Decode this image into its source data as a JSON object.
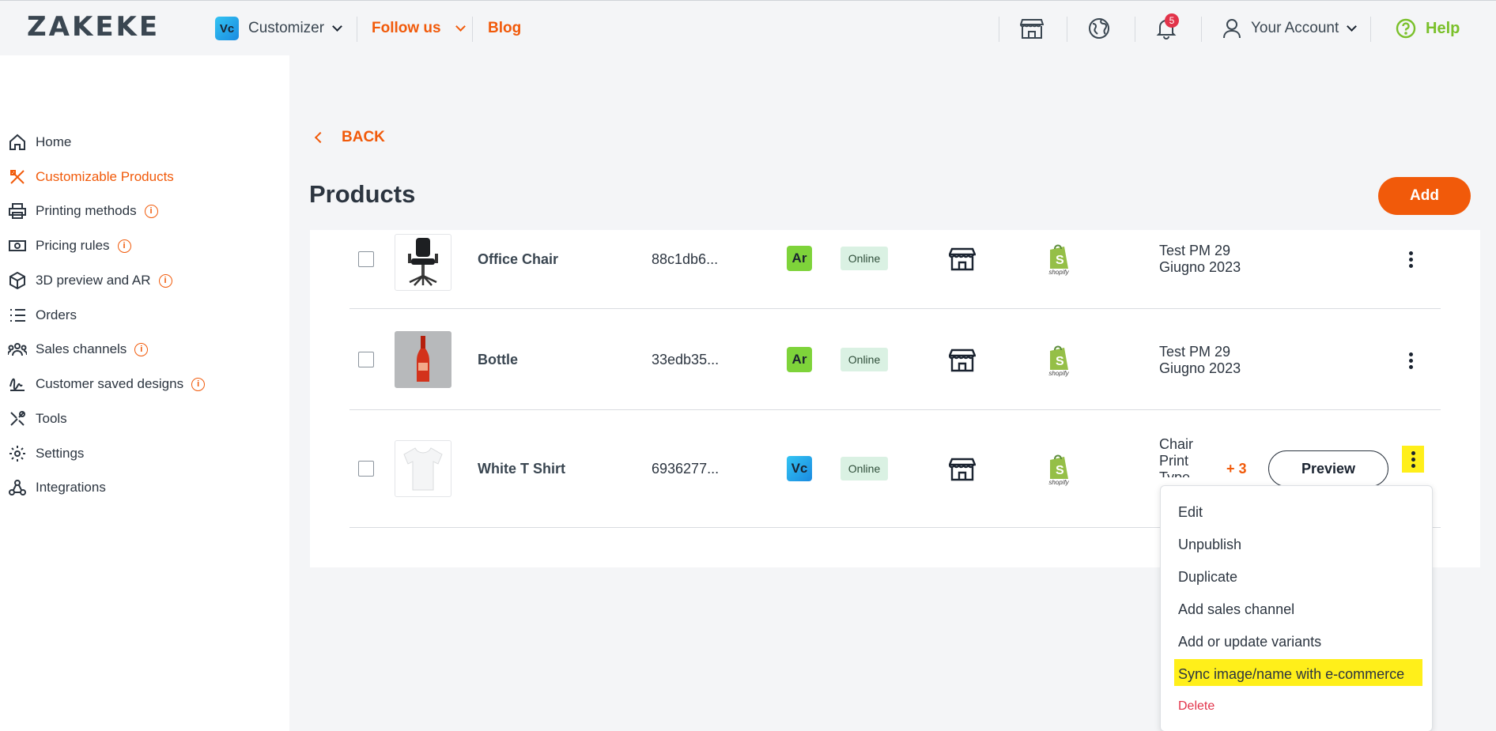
{
  "header": {
    "logo": "ZAKEKE",
    "app_badge": "Vc",
    "app_switcher": "Customizer",
    "follow_us": "Follow us",
    "blog": "Blog",
    "notifications_count": "5",
    "account": "Your Account",
    "help": "Help"
  },
  "sidebar": {
    "items": [
      {
        "label": "Home"
      },
      {
        "label": "Customizable Products"
      },
      {
        "label": "Printing methods"
      },
      {
        "label": "Pricing rules"
      },
      {
        "label": "3D preview and AR"
      },
      {
        "label": "Orders"
      },
      {
        "label": "Sales channels"
      },
      {
        "label": "Customer saved designs"
      },
      {
        "label": "Tools"
      },
      {
        "label": "Settings"
      },
      {
        "label": "Integrations"
      }
    ]
  },
  "main": {
    "back_label": "BACK",
    "title": "Products",
    "add_label": "Add",
    "products": [
      {
        "name": "Office Chair",
        "id": "88c1db6...",
        "tag": "Ar",
        "status": "Online",
        "platform": "shopify",
        "text_line1": "Test PM 29",
        "text_line2": "Giugno 2023"
      },
      {
        "name": "Bottle",
        "id": "33edb35...",
        "tag": "Ar",
        "status": "Online",
        "platform": "shopify",
        "text_line1": "Test PM 29",
        "text_line2": "Giugno 2023"
      },
      {
        "name": "White T Shirt",
        "id": "6936277...",
        "tag": "Vc",
        "status": "Online",
        "platform": "shopify",
        "text_line1": "Chair",
        "text_line2": "Print",
        "text_line3": "Type",
        "extra_count": "+ 3",
        "preview_label": "Preview"
      }
    ]
  },
  "menu": {
    "items": [
      "Edit",
      "Unpublish",
      "Duplicate",
      "Add sales channel",
      "Add or update variants",
      "Sync image/name with e-commerce"
    ],
    "delete": "Delete"
  },
  "colors": {
    "accent": "#f15a0a",
    "highlight": "#ffef1a",
    "help_green": "#7ac02a",
    "online_bg": "#daf1e3"
  }
}
